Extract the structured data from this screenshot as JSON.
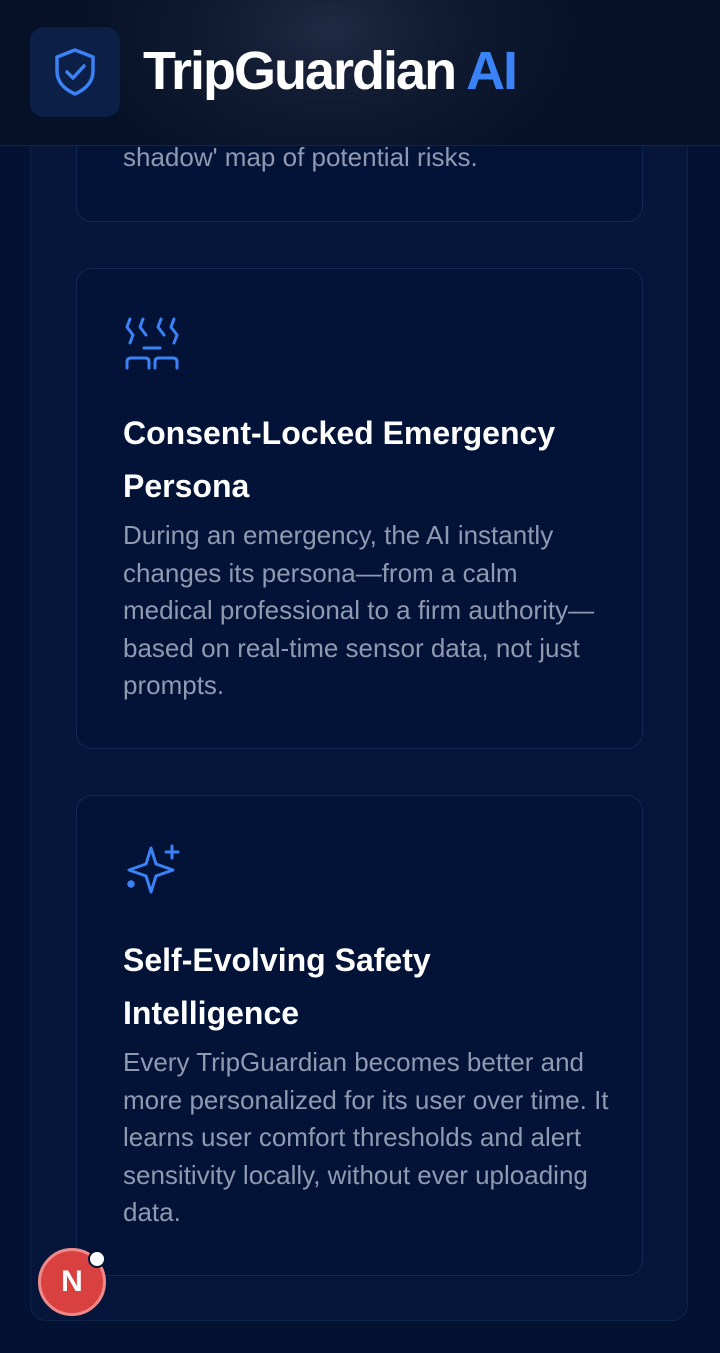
{
  "header": {
    "brand_main": "TripGuardian",
    "brand_accent": "AI",
    "logo_icon": "shield-check-icon"
  },
  "features": [
    {
      "description_tail": "shadow' map of potential risks."
    },
    {
      "icon": "persona-masks-icon",
      "title": "Consent-Locked Emergency Persona",
      "description": "During an emergency, the AI instantly changes its persona—from a calm medical professional to a firm authority—based on real-time sensor data, not just prompts."
    },
    {
      "icon": "sparkles-icon",
      "title": "Self-Evolving Safety Intelligence",
      "description": "Every TripGuardian becomes better and more personalized for its user over time. It learns user comfort thresholds and alert sensitivity locally, without ever uploading data."
    }
  ],
  "floating_badge": {
    "letter": "N"
  },
  "colors": {
    "accent": "#3b82f6",
    "background": "#031233",
    "card": "#031338",
    "badge": "#d94141"
  }
}
